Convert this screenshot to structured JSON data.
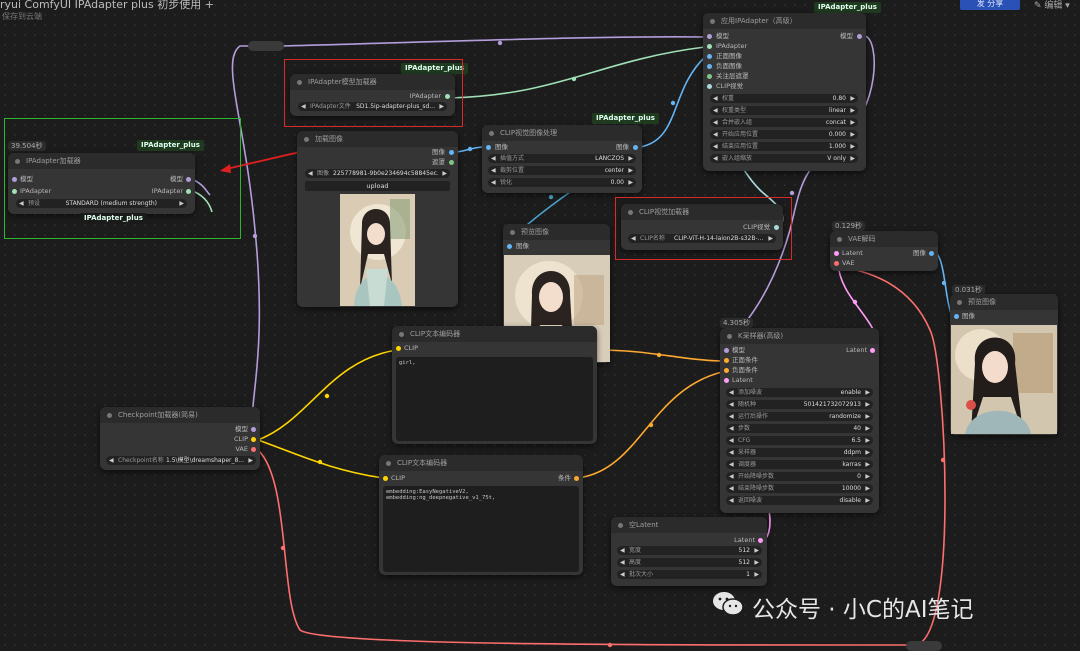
{
  "topbar": {
    "title": "ryui    ComfyUI IPAdapter plus 初步使用  +",
    "subtitle": "保存到云端",
    "share": "发 分享",
    "edit": "✎ 编辑 ▾"
  },
  "colors": {
    "model": "#b39ddb",
    "clip": "#ffd500",
    "vae": "#ff6e6e",
    "image": "#64b5f6",
    "latent": "#ff9cf9",
    "ipadapter": "#9fe0b5",
    "clipvision": "#a8dadc",
    "conditioning": "#ffa931"
  },
  "nodes": {
    "ipa_loader": {
      "title": "IPAdapter模型加载器",
      "out": "IPAdapter",
      "widget_label": "IPAdapter文件",
      "widget_value": "SD1.5ip-adapter-plus_sd..."
    },
    "load_image": {
      "title": "加载图像",
      "out1": "图像",
      "out2": "遮罩",
      "widget_label": "图像",
      "widget_value": "225778981-9b0e234694c58845ec...",
      "upload": "upload"
    },
    "clip_vision_proc": {
      "title": "CLIP视觉图像处理",
      "in": "图像",
      "out": "图像",
      "w1_label": "插值方式",
      "w1_value": "LANCZOS",
      "w2_label": "裁剪位置",
      "w2_value": "center",
      "w3_label": "锐化",
      "w3_value": "0.00"
    },
    "preview1": {
      "title": "预览图像",
      "in": "图像"
    },
    "clip_vision_loader": {
      "title": "CLIP视觉加载器",
      "out": "CLIP视觉",
      "widget_label": "CLIP名称",
      "widget_value": "CLIP-ViT-H-14-laion2B-s32B-..."
    },
    "apply_ipa": {
      "title": "应用IPAdapter（高级）",
      "in1": "模型",
      "in2": "IPAdapter",
      "in3": "正面图像",
      "in4": "负面图像",
      "in5": "关注层遮罩",
      "in6": "CLIP视觉",
      "out": "模型",
      "widgets": [
        [
          "权重",
          "0.80"
        ],
        [
          "权重类型",
          "linear"
        ],
        [
          "合并嵌入组",
          "concat"
        ],
        [
          "开始应用位置",
          "0.000"
        ],
        [
          "结束应用位置",
          "1.000"
        ],
        [
          "嵌入组缩放",
          "V only"
        ]
      ]
    },
    "vae_decode": {
      "title": "VAE解码",
      "time": "0.129秒",
      "in1": "Latent",
      "in2": "VAE",
      "out": "图像"
    },
    "preview2": {
      "title": "预览图像",
      "time": "0.031秒",
      "in": "图像"
    },
    "ipa_plus_loader": {
      "title": "IPAdapter加载器",
      "time": "39.504秒",
      "in1": "模型",
      "in2": "IPAdapter",
      "out1": "模型",
      "out2": "IPAdapter",
      "widget_label": "预设",
      "widget_value": "STANDARD (medium strength)",
      "tag": "IPAdapter_plus",
      "tag2": "IPAdapter_plus"
    },
    "clip_text_pos": {
      "title": "CLIP文本编码器",
      "in": "CLIP",
      "text": "girl,"
    },
    "clip_text_neg": {
      "title": "CLIP文本编码器",
      "in": "CLIP",
      "out": "条件",
      "text": "embedding:EasyNegativeV2, embedding:ng_deepnegative_v1_75t,"
    },
    "checkpoint": {
      "title": "Checkpoint加载器(简易)",
      "out1": "模型",
      "out2": "CLIP",
      "out3": "VAE",
      "widget_label": "Checkpoint名称",
      "widget_value": "1.5\\模型\\dreamshaper_8..."
    },
    "ksampler": {
      "title": "K采样器(高级)",
      "time": "4.305秒",
      "in1": "模型",
      "in2": "正面条件",
      "in3": "负面条件",
      "in4": "Latent",
      "out": "Latent",
      "widgets": [
        [
          "添加噪波",
          "enable"
        ],
        [
          "随机种",
          "501421732072913"
        ],
        [
          "运行后操作",
          "randomize"
        ],
        [
          "步数",
          "40"
        ],
        [
          "CFG",
          "6.5"
        ],
        [
          "采样器",
          "ddpm"
        ],
        [
          "调度器",
          "karras"
        ],
        [
          "开始降噪步数",
          "0"
        ],
        [
          "结束降噪步数",
          "10000"
        ],
        [
          "返回噪波",
          "disable"
        ]
      ]
    },
    "empty_latent": {
      "title": "空Latent",
      "out": "Latent",
      "widgets": [
        [
          "宽度",
          "512"
        ],
        [
          "高度",
          "512"
        ],
        [
          "批次大小",
          "1"
        ]
      ]
    }
  },
  "tags": {
    "ipa_model": "IPAdapter_plus",
    "clipvision": "IPAdapter_plus",
    "apply": "IPAdapter_plus"
  },
  "watermark": "公众号 · 小C的AI笔记"
}
